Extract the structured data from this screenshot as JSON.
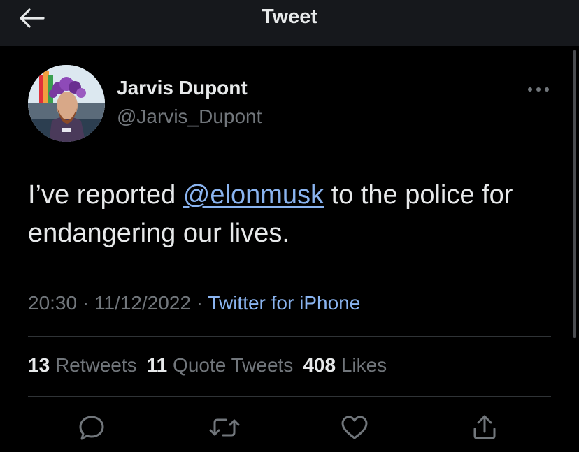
{
  "header": {
    "title": "Tweet",
    "back_icon": "arrow-left-icon"
  },
  "author": {
    "name": "Jarvis Dupont",
    "handle": "@Jarvis_Dupont"
  },
  "tweet": {
    "text_before": "I’ve reported ",
    "mention": "@elonmusk",
    "text_after": " to the police for endangering our lives."
  },
  "meta": {
    "time": "20:30",
    "separator": " · ",
    "date": "11/12/2022",
    "source": "Twitter for iPhone"
  },
  "stats": {
    "retweets_count": "13",
    "retweets_label": "Retweets",
    "quotes_count": "11",
    "quotes_label": "Quote Tweets",
    "likes_count": "408",
    "likes_label": "Likes"
  },
  "actions": [
    "reply-icon",
    "retweet-icon",
    "like-icon",
    "share-icon"
  ],
  "colors": {
    "background": "#000000",
    "header": "#16181c",
    "text": "#e7e9ea",
    "muted": "#71767b",
    "link": "#8ab4f0",
    "divider": "#2f3336"
  }
}
